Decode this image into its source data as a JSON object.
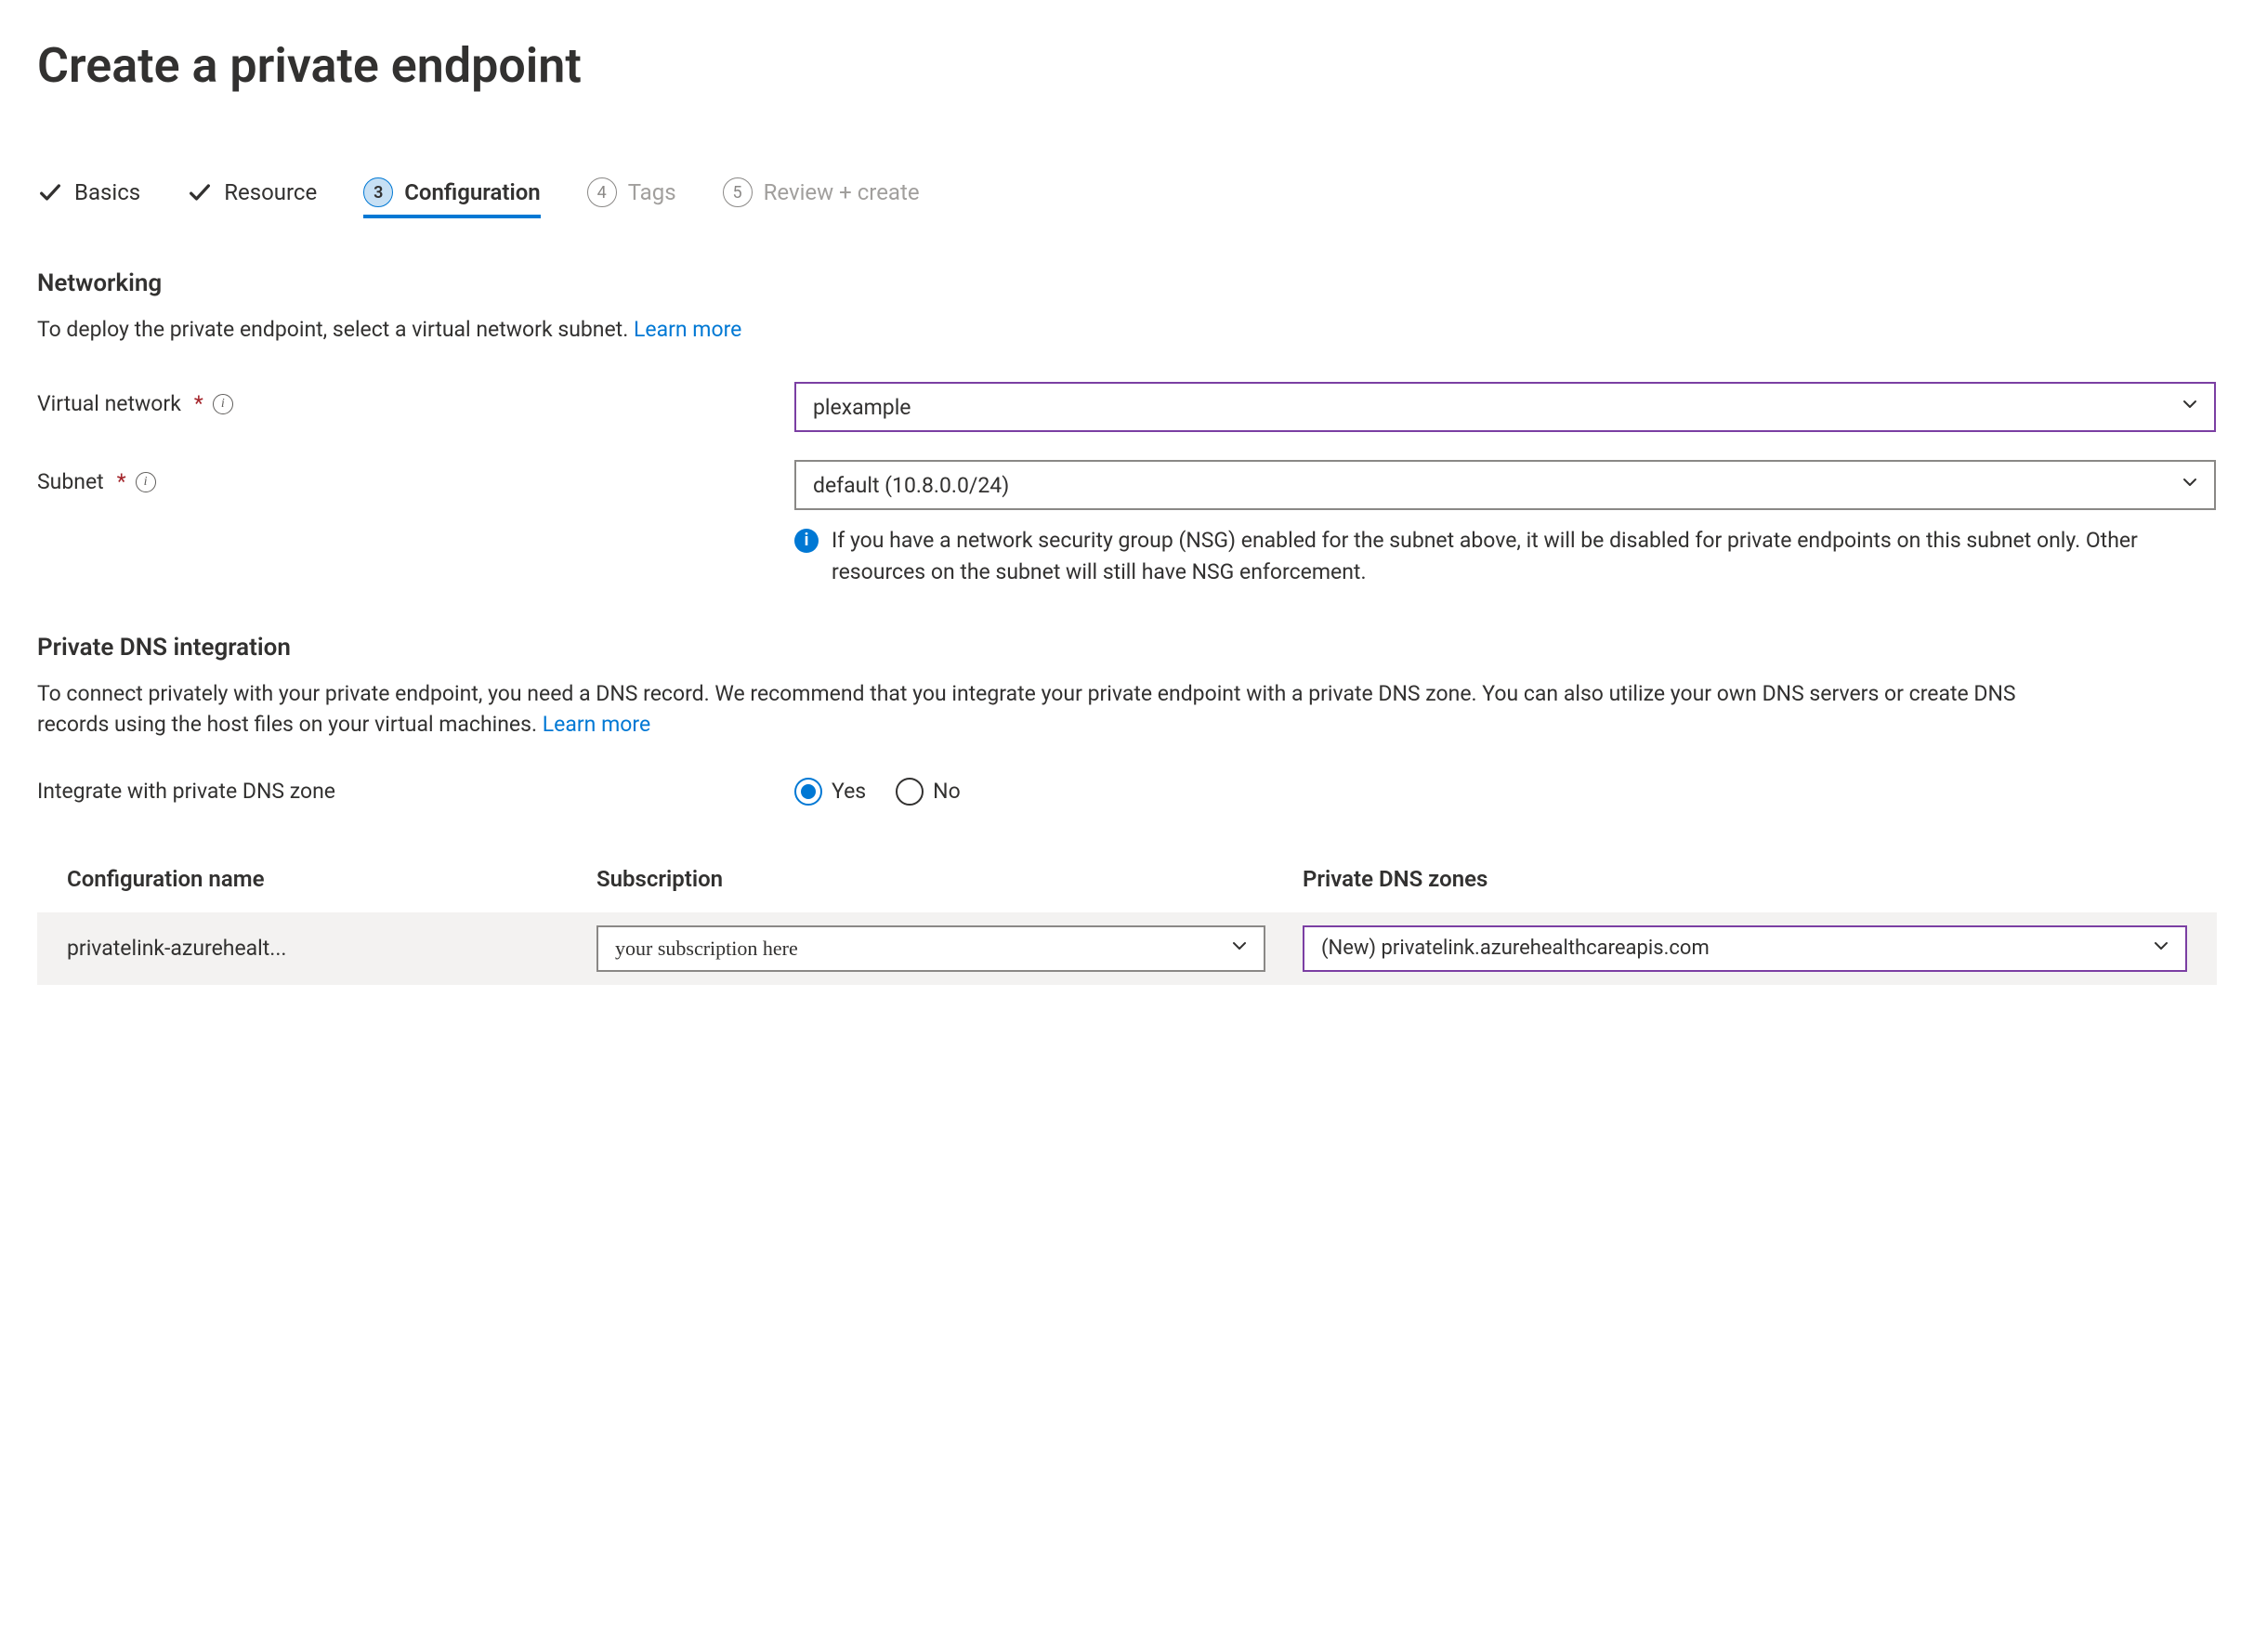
{
  "page": {
    "title": "Create a private endpoint"
  },
  "stepper": {
    "steps": [
      {
        "label": "Basics",
        "state": "done"
      },
      {
        "label": "Resource",
        "state": "done"
      },
      {
        "number": "3",
        "label": "Configuration",
        "state": "active"
      },
      {
        "number": "4",
        "label": "Tags",
        "state": "future"
      },
      {
        "number": "5",
        "label": "Review + create",
        "state": "future"
      }
    ]
  },
  "networking": {
    "heading": "Networking",
    "desc": "To deploy the private endpoint, select a virtual network subnet.  ",
    "learn_more": "Learn more",
    "vnet_label": "Virtual network",
    "vnet_value": "plexample",
    "subnet_label": "Subnet",
    "subnet_value": "default (10.8.0.0/24)",
    "nsg_note": "If you have a network security group (NSG) enabled for the subnet above, it will be disabled for private endpoints on this subnet only. Other resources on the subnet will still have NSG enforcement."
  },
  "dns": {
    "heading": "Private DNS integration",
    "desc": "To connect privately with your private endpoint, you need a DNS record. We recommend that you integrate your private endpoint with a private DNS zone. You can also utilize your own DNS servers or create DNS records using the host files on your virtual machines.  ",
    "learn_more": "Learn more",
    "integrate_label": "Integrate with private DNS zone",
    "radio_yes": "Yes",
    "radio_no": "No",
    "radio_selected": "yes",
    "table": {
      "col_config": "Configuration name",
      "col_subscription": "Subscription",
      "col_zone": "Private DNS zones",
      "rows": [
        {
          "config_name": "privatelink-azurehealt...",
          "subscription": "your subscription here",
          "zone": "(New) privatelink.azurehealthcareapis.com"
        }
      ]
    }
  }
}
